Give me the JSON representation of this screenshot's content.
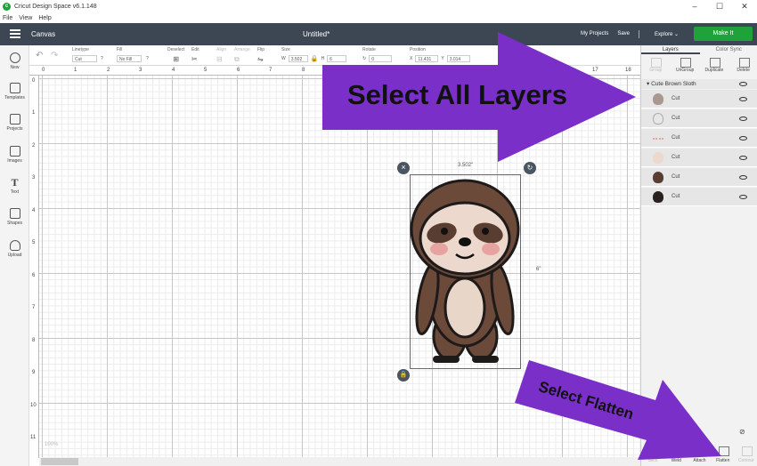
{
  "window": {
    "title": "Cricut Design Space  v6.1.148",
    "controls": [
      "–",
      "☐",
      "✕"
    ]
  },
  "menu": [
    "File",
    "View",
    "Help"
  ],
  "header": {
    "section": "Canvas",
    "doc_title": "Untitled*",
    "my_projects": "My Projects",
    "save": "Save",
    "explore": "Explore",
    "make_it": "Make It"
  },
  "toolbar": {
    "linetype": {
      "label": "Linetype",
      "value": "Cut"
    },
    "fill": {
      "label": "Fill",
      "value": "No Fill"
    },
    "deselect": "Deselect",
    "edit": "Edit",
    "align": "Align",
    "arrange": "Arrange",
    "flip": "Flip",
    "size": {
      "label": "Size",
      "w_label": "W",
      "w": "3.502",
      "h_label": "H",
      "h": "6"
    },
    "rotate": {
      "label": "Rotate",
      "value": "0"
    },
    "position": {
      "label": "Position",
      "x_label": "X",
      "x": "11.431",
      "y_label": "Y",
      "y": "3.014"
    },
    "help": "?"
  },
  "leftbar": [
    "New",
    "Templates",
    "Projects",
    "Images",
    "Text",
    "Shapes",
    "Upload"
  ],
  "ruler": {
    "top": [
      "0",
      "1",
      "2",
      "3",
      "4",
      "5",
      "6",
      "7",
      "8",
      "9",
      "10",
      "11",
      "12",
      "13",
      "14",
      "15",
      "16",
      "17",
      "18"
    ],
    "left": [
      "0",
      "1",
      "2",
      "3",
      "4",
      "5",
      "6",
      "7",
      "8",
      "9",
      "10",
      "11"
    ]
  },
  "canvas": {
    "width_label": "3.502\"",
    "height_label": "6\"",
    "zoom": "100%"
  },
  "panel": {
    "tabs": [
      "Layers",
      "Color Sync"
    ],
    "actions": [
      "Group",
      "UnGroup",
      "Duplicate",
      "Delete"
    ],
    "group_name": "Cute Brown Sloth",
    "layers": [
      {
        "name": "Cut",
        "color": "#6b4a3a"
      },
      {
        "name": "Cut",
        "color": "#d9d0c8"
      },
      {
        "name": "Cut",
        "color": "#e6a3a0"
      },
      {
        "name": "Cut",
        "color": "#ecd8cc"
      },
      {
        "name": "Cut",
        "color": "#5a3d31"
      },
      {
        "name": "Cut",
        "color": "#2a2020"
      }
    ],
    "bottom_actions": [
      "Slice",
      "Weld",
      "Attach",
      "Flatten",
      "Contour"
    ]
  },
  "annotations": {
    "callout_top": "Select All Layers",
    "callout_bottom": "Select Flatten",
    "color": "#7a2fc9"
  }
}
